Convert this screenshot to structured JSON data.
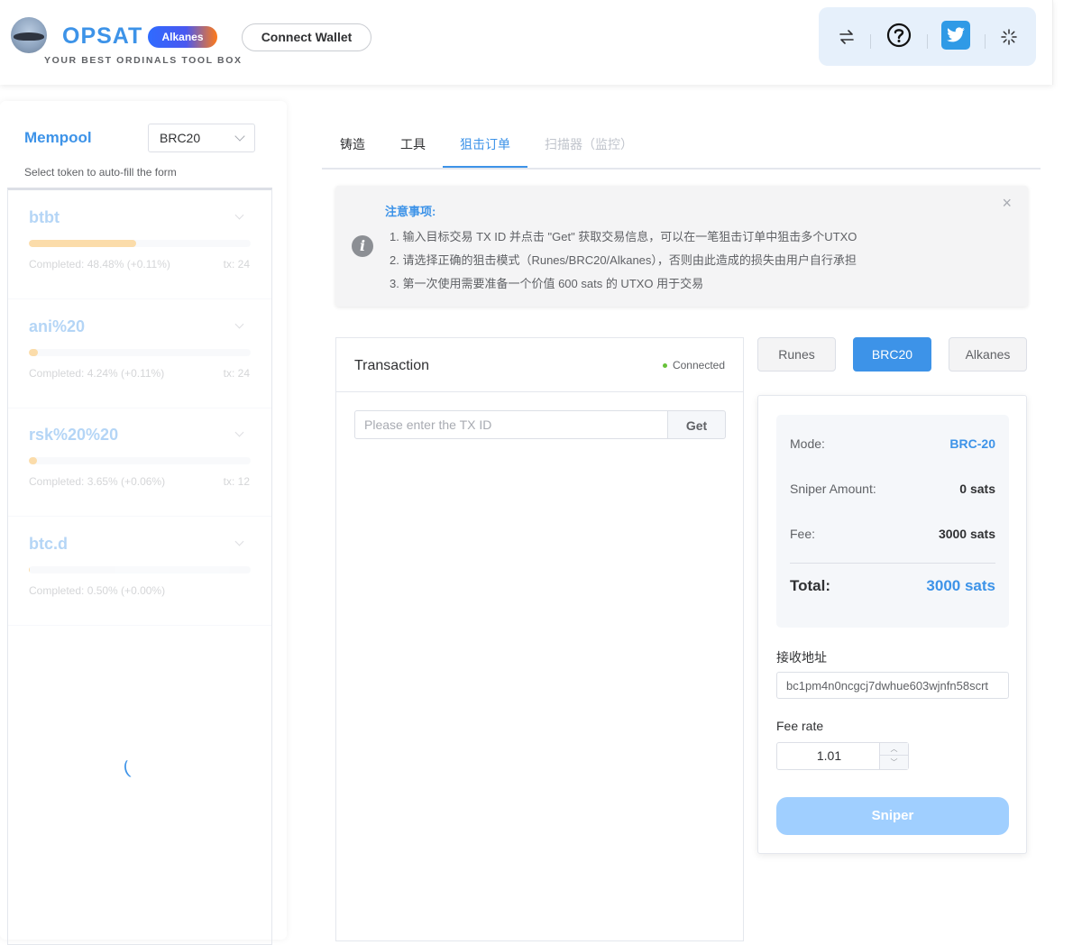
{
  "header": {
    "brand": "OPSAT",
    "badge": "Alkanes",
    "tagline": "YOUR BEST ORDINALS TOOL BOX",
    "connect_wallet": "Connect Wallet",
    "toolbar_icons": [
      "swap-icon",
      "help-circle-icon",
      "twitter-icon",
      "loading-spinner-icon"
    ],
    "twitter_color": "#2f9ae6"
  },
  "sidebar": {
    "title": "Mempool",
    "select_value": "BRC20",
    "hint": "Select token to auto-fill the form",
    "tokens": [
      {
        "name": "btbt",
        "progress": 0.4848,
        "completed": "Completed: 48.48% (+0.11%)",
        "tx": "tx: 24"
      },
      {
        "name": "ani%20",
        "progress": 0.0424,
        "completed": "Completed: 4.24% (+0.11%)",
        "tx": "tx: 24"
      },
      {
        "name": "rsk%20%20",
        "progress": 0.0365,
        "completed": "Completed: 3.65% (+0.06%)",
        "tx": "tx: 12"
      },
      {
        "name": "btc.d",
        "progress": 0.005,
        "completed": "Completed: 0.50% (+0.00%)",
        "tx": ""
      }
    ]
  },
  "tabs": [
    {
      "label": "铸造",
      "state": "normal"
    },
    {
      "label": "工具",
      "state": "normal"
    },
    {
      "label": "狙击订单",
      "state": "active"
    },
    {
      "label": "扫描器（监控）",
      "state": "disabled"
    }
  ],
  "notice": {
    "title": "注意事项:",
    "lines": [
      "1. 输入目标交易 TX ID 并点击 \"Get\" 获取交易信息，可以在一笔狙击订单中狙击多个UTXO",
      "2. 请选择正确的狙击模式（Runes/BRC20/Alkanes），否则由此造成的损失由用户自行承担",
      "3. 第一次使用需要准备一个价值 600 sats 的 UTXO 用于交易"
    ]
  },
  "transaction": {
    "title": "Transaction",
    "status": "Connected",
    "placeholder": "Please enter the TX ID",
    "get_label": "Get"
  },
  "modes": [
    {
      "label": "Runes",
      "active": false
    },
    {
      "label": "BRC20",
      "active": true
    },
    {
      "label": "Alkanes",
      "active": false
    }
  ],
  "summary": {
    "mode_label": "Mode:",
    "mode_value": "BRC-20",
    "amount_label": "Sniper Amount:",
    "amount_value": "0 sats",
    "fee_label": "Fee:",
    "fee_value": "3000 sats",
    "total_label": "Total:",
    "total_value": "3000 sats"
  },
  "form": {
    "address_label": "接收地址",
    "address_value": "bc1pm4n0ncgcj7dwhue603wjnfn58scrt",
    "fee_rate_label": "Fee rate",
    "fee_rate_value": "1.01",
    "sniper_label": "Sniper"
  },
  "colors": {
    "accent": "#3d93e8",
    "progress": "#f5a623",
    "status_ok": "#67c23a",
    "button_disabled": "#a0cfff"
  }
}
